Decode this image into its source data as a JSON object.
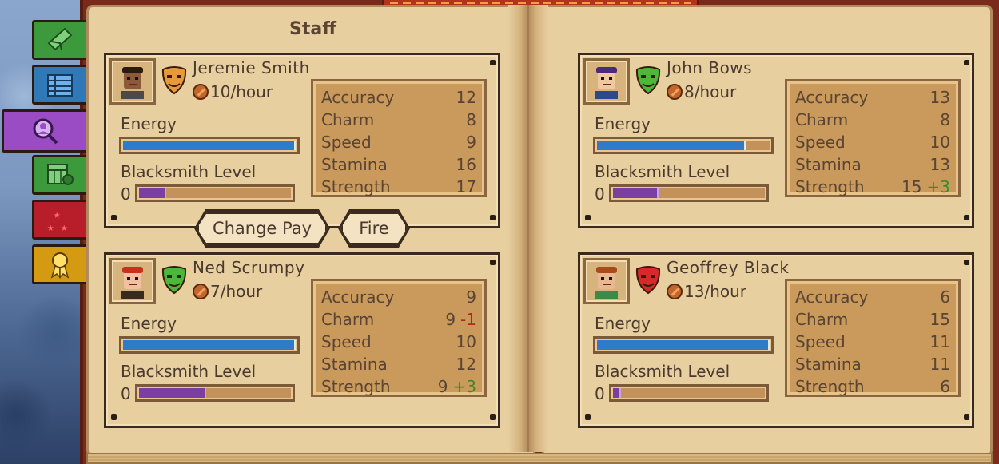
{
  "page": {
    "title": "Staff"
  },
  "actions": {
    "change_pay": "Change Pay",
    "fire": "Fire"
  },
  "labels": {
    "energy": "Energy",
    "level": "Blacksmith Level"
  },
  "tabs": [
    {
      "name": "quests-tab",
      "icon": "envelope-icon",
      "color": "#3c9a3c"
    },
    {
      "name": "ledger-tab",
      "icon": "ledger-icon",
      "color": "#2f79b8"
    },
    {
      "name": "staff-tab",
      "icon": "search-staff-icon",
      "color": "#9a4cc4",
      "active": true
    },
    {
      "name": "calendar-tab",
      "icon": "calendar-icon",
      "color": "#3c9a3c"
    },
    {
      "name": "rating-tab",
      "icon": "stars-icon",
      "color": "#b81e2a"
    },
    {
      "name": "awards-tab",
      "icon": "ribbon-icon",
      "color": "#d39a12"
    }
  ],
  "staff": [
    {
      "name": "Jeremie Smith",
      "wage": "10/hour",
      "mood": "orange",
      "energy": 1.0,
      "level": "0",
      "level_progress": 0.18,
      "stats": [
        {
          "label": "Accuracy",
          "value": "12",
          "mod": ""
        },
        {
          "label": "Charm",
          "value": "8",
          "mod": ""
        },
        {
          "label": "Speed",
          "value": "9",
          "mod": ""
        },
        {
          "label": "Stamina",
          "value": "16",
          "mod": ""
        },
        {
          "label": "Strength",
          "value": "17",
          "mod": ""
        }
      ]
    },
    {
      "name": "John Bows",
      "wage": "8/hour",
      "mood": "green",
      "energy": 0.86,
      "level": "0",
      "level_progress": 0.3,
      "stats": [
        {
          "label": "Accuracy",
          "value": "13",
          "mod": ""
        },
        {
          "label": "Charm",
          "value": "8",
          "mod": ""
        },
        {
          "label": "Speed",
          "value": "10",
          "mod": ""
        },
        {
          "label": "Stamina",
          "value": "13",
          "mod": ""
        },
        {
          "label": "Strength",
          "value": "15",
          "mod": "+3"
        }
      ]
    },
    {
      "name": "Ned Scrumpy",
      "wage": "7/hour",
      "mood": "green",
      "energy": 1.0,
      "level": "0",
      "level_progress": 0.44,
      "stats": [
        {
          "label": "Accuracy",
          "value": "9",
          "mod": ""
        },
        {
          "label": "Charm",
          "value": "9",
          "mod": "-1"
        },
        {
          "label": "Speed",
          "value": "10",
          "mod": ""
        },
        {
          "label": "Stamina",
          "value": "12",
          "mod": ""
        },
        {
          "label": "Strength",
          "value": "9",
          "mod": "+3"
        }
      ]
    },
    {
      "name": "Geoffrey Black",
      "wage": "13/hour",
      "mood": "red",
      "energy": 1.0,
      "level": "0",
      "level_progress": 0.05,
      "stats": [
        {
          "label": "Accuracy",
          "value": "6",
          "mod": ""
        },
        {
          "label": "Charm",
          "value": "15",
          "mod": ""
        },
        {
          "label": "Speed",
          "value": "11",
          "mod": ""
        },
        {
          "label": "Stamina",
          "value": "11",
          "mod": ""
        },
        {
          "label": "Strength",
          "value": "6",
          "mod": ""
        }
      ]
    }
  ],
  "colors": {
    "mask_orange": "#e89a3a",
    "mask_green": "#4cb83a",
    "mask_red": "#d8282a",
    "energy": "#2f7acb",
    "level": "#7a3fa0"
  }
}
